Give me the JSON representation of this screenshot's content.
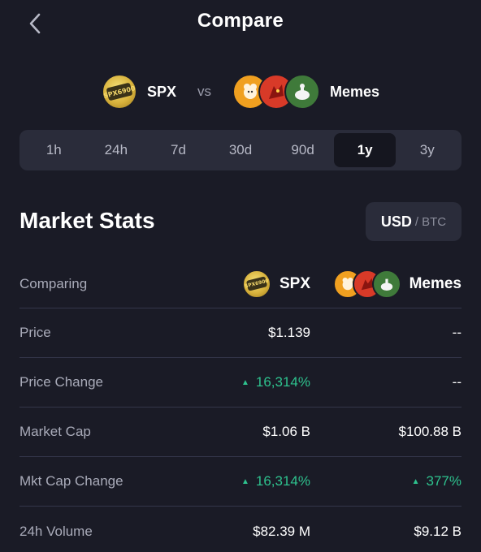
{
  "header": {
    "title": "Compare"
  },
  "compare": {
    "left_label": "SPX",
    "vs": "vs",
    "right_label": "Memes",
    "spx_logo_text": "SPX6900"
  },
  "timeframes": {
    "tabs": [
      "1h",
      "24h",
      "7d",
      "30d",
      "90d",
      "1y",
      "3y"
    ],
    "active": "1y"
  },
  "stats": {
    "title": "Market Stats",
    "currency_active": "USD",
    "currency_sep": "/",
    "currency_inactive": "BTC",
    "header": {
      "label": "Comparing",
      "spx": "SPX",
      "memes": "Memes"
    },
    "rows": [
      {
        "label": "Price",
        "spx": "$1.139",
        "memes": "--"
      },
      {
        "label": "Price Change",
        "spx": "16,314%",
        "memes": "--"
      },
      {
        "label": "Market Cap",
        "spx": "$1.06 B",
        "memes": "$100.88 B"
      },
      {
        "label": "Mkt Cap Change",
        "spx": "16,314%",
        "memes": "377%"
      },
      {
        "label": "24h Volume",
        "spx": "$82.39 M",
        "memes": "$9.12 B"
      }
    ]
  },
  "colors": {
    "background": "#1a1b26",
    "positive": "#2ec28e",
    "panel": "#2a2c3a"
  },
  "icons": [
    "back-chevron-icon",
    "spx-coin-icon",
    "meme-coin-doge-icon",
    "meme-coin-dragon-icon",
    "meme-coin-goose-icon",
    "up-triangle-icon"
  ]
}
